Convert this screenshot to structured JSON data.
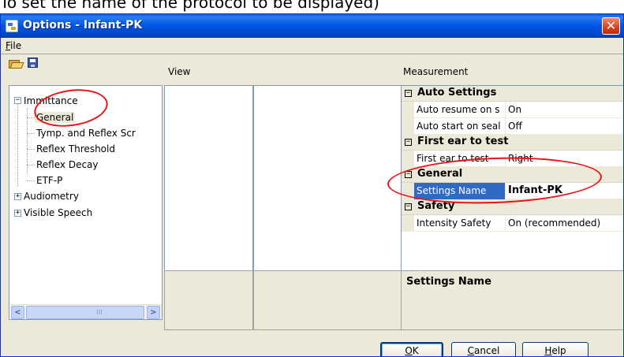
{
  "page_caption": "To set the name of the protocol to be displayed)",
  "window": {
    "title": "Options - Infant-PK",
    "close_glyph": "✕"
  },
  "menu": {
    "file": "File"
  },
  "toolbar": {
    "open_icon": "open-folder-icon",
    "save_icon": "save-disk-icon"
  },
  "columns": {
    "view": "View",
    "measurement": "Measurement"
  },
  "tree": {
    "root_immittance": "Immittance",
    "general": "General",
    "tymp_reflex": "Tymp. and Reflex Scr",
    "reflex_threshold": "Reflex Threshold",
    "reflex_decay": "Reflex Decay",
    "etf_p": "ETF-P",
    "audiometry": "Audiometry",
    "visible_speech": "Visible Speech",
    "expand_glyph": "+",
    "collapse_glyph": "−"
  },
  "scrollbar": {
    "left_glyph": "<",
    "right_glyph": ">",
    "grip_glyph": "III"
  },
  "properties": {
    "collapse_glyph": "−",
    "auto_settings": {
      "title": "Auto Settings",
      "auto_resume_label": "Auto resume on s",
      "auto_resume_value": "On",
      "auto_start_label": "Auto start on seal",
      "auto_start_value": "Off"
    },
    "first_ear": {
      "title": "First ear to test",
      "label": "First ear to test",
      "value": "Right"
    },
    "general": {
      "title": "General",
      "settings_name_label": "Settings Name",
      "settings_name_value": "Infant-PK"
    },
    "safety": {
      "title": "Safety",
      "intensity_label": "Intensity Safety",
      "intensity_value": "On (recommended)"
    }
  },
  "description": {
    "title": "Settings Name"
  },
  "buttons": {
    "ok": "OK",
    "cancel": "Cancel",
    "help": "Help"
  },
  "colors": {
    "title_bar": "#0058e6",
    "selection": "#316ac5",
    "annotation": "#e8141a",
    "window_bg": "#ece9d8"
  }
}
